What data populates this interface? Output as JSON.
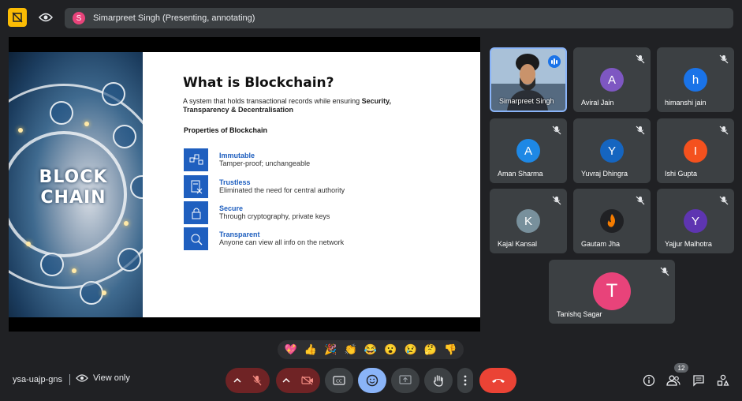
{
  "top": {
    "presenter_initial": "S",
    "presenter_text": "Simarpreet Singh (Presenting, annotating)"
  },
  "slide": {
    "image_text": "BLOCK CHAIN",
    "title": "What is Blockchain?",
    "subtitle_plain": "A system that holds transactional records while ensuring ",
    "subtitle_bold": "Security, Transparency & Decentralisation",
    "properties_heading": "Properties of Blockchain",
    "properties": [
      {
        "title": "Immutable",
        "desc": "Tamper-proof; unchangeable"
      },
      {
        "title": "Trustless",
        "desc": "Eliminated the need for central authority"
      },
      {
        "title": "Secure",
        "desc": "Through cryptography, private keys"
      },
      {
        "title": "Transparent",
        "desc": "Anyone can view all info on the network"
      }
    ]
  },
  "participants": [
    {
      "name": "Simarpreet Singh",
      "initial": "",
      "color": ""
    },
    {
      "name": "Aviral Jain",
      "initial": "A",
      "color": "#7e57c2"
    },
    {
      "name": "himanshi jain",
      "initial": "h",
      "color": "#1a73e8"
    },
    {
      "name": "Aman Sharma",
      "initial": "A",
      "color": "#1e88e5"
    },
    {
      "name": "Yuvraj Dhingra",
      "initial": "Y",
      "color": "#1565c0"
    },
    {
      "name": "Ishi Gupta",
      "initial": "I",
      "color": "#f4511e"
    },
    {
      "name": "Kajal Kansal",
      "initial": "K",
      "color": "#78909c"
    },
    {
      "name": "Gautam Jha",
      "initial": "",
      "color": "#202124"
    },
    {
      "name": "Yajjur Malhotra",
      "initial": "Y",
      "color": "#5e35b1"
    },
    {
      "name": "Tanishq Sagar",
      "initial": "T",
      "color": "#e8437a"
    }
  ],
  "reactions": [
    "💖",
    "👍",
    "🎉",
    "👏",
    "😂",
    "😮",
    "😢",
    "🤔",
    "👎"
  ],
  "bottom": {
    "meeting_code": "ysa-uajp-gns",
    "view_only": "View only",
    "people_count": "12"
  }
}
